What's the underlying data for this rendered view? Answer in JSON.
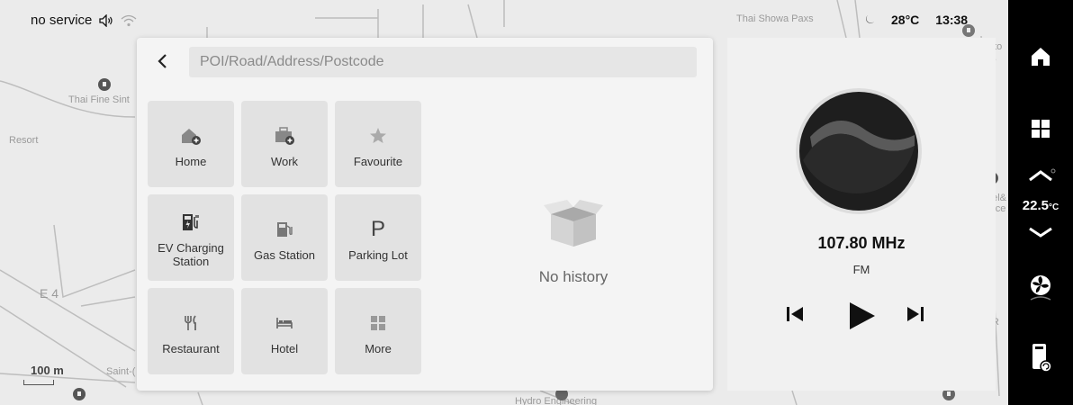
{
  "status": {
    "network": "no service",
    "outside_temp": "28°C",
    "time": "13:38"
  },
  "map": {
    "labels": [
      "Thai Fine Sint",
      "Resort",
      "E 4",
      "Saint-(",
      "Thai Showa Paxs",
      "100 m",
      "uto",
      "d.",
      "eel&",
      "roce",
      "R",
      "Hydro Engineering"
    ],
    "scale": "100 m"
  },
  "search": {
    "placeholder": "POI/Road/Address/Postcode"
  },
  "categories": [
    {
      "label": "Home",
      "icon": "home-add-icon"
    },
    {
      "label": "Work",
      "icon": "briefcase-add-icon"
    },
    {
      "label": "Favourite",
      "icon": "star-icon"
    },
    {
      "label": "EV Charging Station",
      "icon": "ev-charging-icon"
    },
    {
      "label": "Gas Station",
      "icon": "gas-station-icon"
    },
    {
      "label": "Parking Lot",
      "icon": "parking-icon"
    },
    {
      "label": "Restaurant",
      "icon": "restaurant-icon"
    },
    {
      "label": "Hotel",
      "icon": "hotel-icon"
    },
    {
      "label": "More",
      "icon": "grid-icon"
    }
  ],
  "history": {
    "empty_label": "No history"
  },
  "media": {
    "frequency": "107.80 MHz",
    "band": "FM"
  },
  "sidebar": {
    "temperature": "22.5",
    "temperature_unit": "°C"
  }
}
